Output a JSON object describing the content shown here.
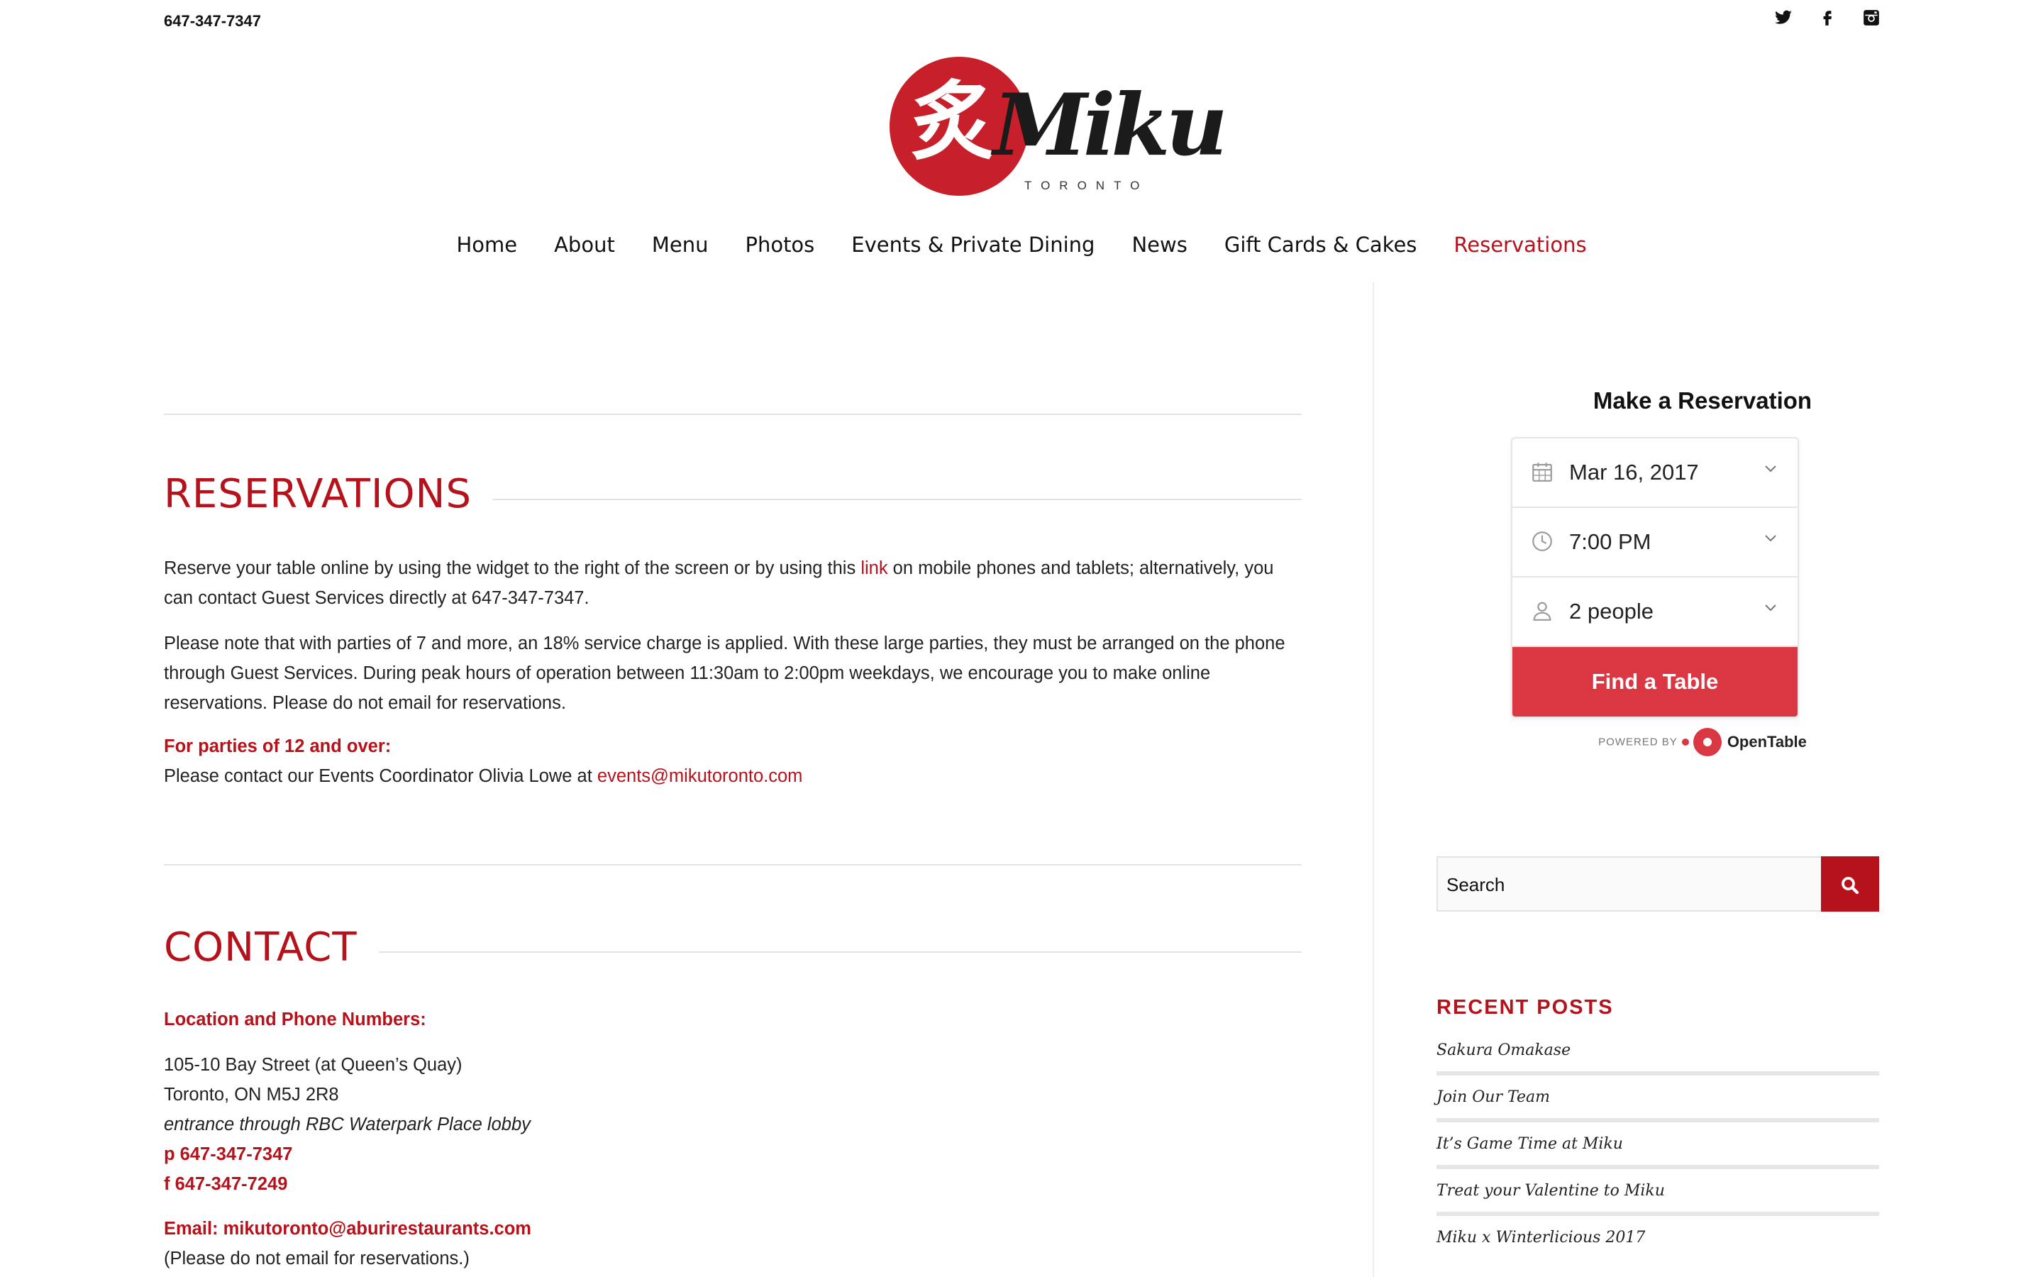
{
  "header": {
    "phone": "647-347-7347",
    "social": [
      {
        "icon": "twitter-icon",
        "glyph": "𝕥"
      },
      {
        "icon": "facebook-icon",
        "glyph": "f"
      },
      {
        "icon": "instagram-icon",
        "glyph": "◙"
      }
    ],
    "logo": {
      "kanji": "炙",
      "brand": "Miku",
      "city": "TORONTO"
    }
  },
  "nav": {
    "items": [
      "Home",
      "About",
      "Menu",
      "Photos",
      "Events & Private Dining",
      "News",
      "Gift Cards & Cakes",
      "Reservations"
    ],
    "active": "Reservations"
  },
  "reservations": {
    "title": "RESERVATIONS",
    "p1_before": "Reserve your table online by using the widget to the right of the screen or by using this ",
    "p1_link": "link",
    "p1_after": " on mobile phones and tablets; alternatively, you can contact Guest Services directly at 647-347-7347.",
    "p2": "Please note that with parties of 7 and more, an 18% service charge is applied. With these large parties, they must be arranged on the phone through Guest Services. During peak hours of operation between 11:30am to 2:00pm weekdays, we encourage you to make online reservations. Please do not email for reservations.",
    "large_parties_heading": "For parties of 12 and over:",
    "large_parties_text": "Please contact our Events Coordinator Olivia Lowe at ",
    "events_email": "events@mikutoronto.com"
  },
  "contact": {
    "title": "CONTACT",
    "location_heading": "Location and Phone Numbers:",
    "address_line1": "105-10 Bay Street (at Queen’s Quay)",
    "address_line2": "Toronto, ON M5J 2R8",
    "address_note": "entrance through RBC Waterpark Place lobby",
    "phone": "p 647-347-7347",
    "fax": "f 647-347-7249",
    "email_line": "Email: mikutoronto@aburirestaurants.com",
    "email_note": "(Please do not email for reservations.)"
  },
  "widget": {
    "title": "Make a Reservation",
    "date": "Mar 16, 2017",
    "time": "7:00 PM",
    "party": "2 people",
    "button": "Find a Table",
    "powered_by": "POWERED BY",
    "provider": "OpenTable"
  },
  "search": {
    "placeholder": "Search"
  },
  "recent_posts": {
    "title": "RECENT POSTS",
    "items": [
      "Sakura Omakase",
      "Join Our Team",
      "It’s Game Time at Miku",
      "Treat your Valentine to Miku",
      "Miku x Winterlicious 2017"
    ]
  },
  "colors": {
    "accent": "#b5121b",
    "opentable": "#da3743"
  }
}
